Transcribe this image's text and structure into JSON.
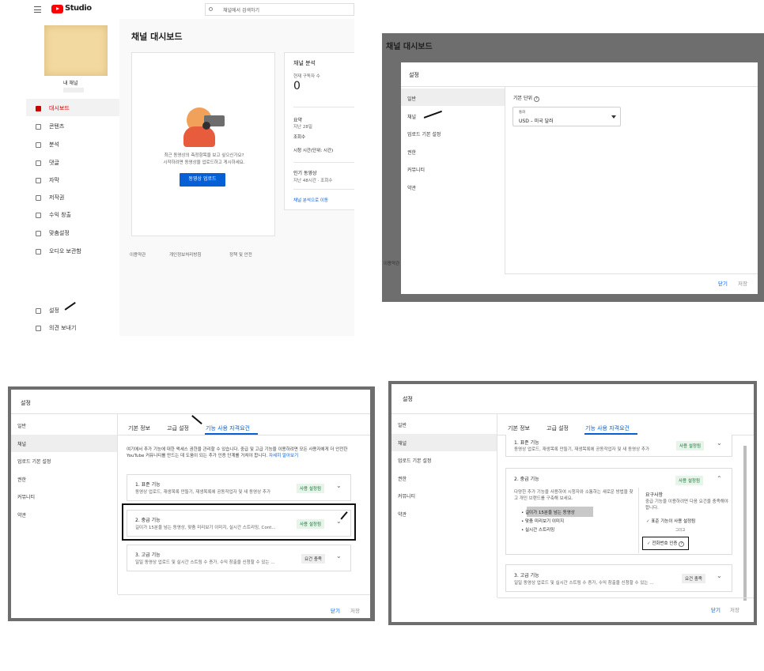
{
  "panel1": {
    "logo_text": "Studio",
    "search_placeholder": "채널에서 검색하기",
    "channel_name": "내 채널",
    "menu": [
      {
        "label": "대시보드",
        "icon": "dashboard-icon"
      },
      {
        "label": "콘텐츠",
        "icon": "content-icon"
      },
      {
        "label": "분석",
        "icon": "analytics-icon"
      },
      {
        "label": "댓글",
        "icon": "comments-icon"
      },
      {
        "label": "자막",
        "icon": "subtitles-icon"
      },
      {
        "label": "저작권",
        "icon": "copyright-icon"
      },
      {
        "label": "수익 창출",
        "icon": "monetization-icon"
      },
      {
        "label": "맞춤설정",
        "icon": "customization-icon"
      },
      {
        "label": "오디오 보관함",
        "icon": "audio-library-icon"
      },
      {
        "label": "설정",
        "icon": "settings-icon"
      },
      {
        "label": "의견 보내기",
        "icon": "feedback-icon"
      }
    ],
    "page_title": "채널 대시보드",
    "upload_card": {
      "line1": "최근 동영상의 측정항목을 보고 싶으신가요?",
      "line2": "시작하려면 동영상을 업로드하고 게시하세요.",
      "button": "동영상 업로드"
    },
    "analytics": {
      "title": "채널 분석",
      "subs_label": "현재 구독자 수",
      "subs_value": "0",
      "summary_title": "요약",
      "summary_period": "지난 28일",
      "views_label": "조회수",
      "watch_label": "시청 시간(단위: 시간)",
      "popular_title": "인기 동영상",
      "popular_period": "지난 48시간 · 조회수",
      "link": "채널 분석으로 이동"
    },
    "footer": [
      "이용약관",
      "개인정보처리방침",
      "정책 및 안전"
    ]
  },
  "panel2": {
    "bg_title": "채널 대시보드",
    "bg_footer": "이용약관",
    "dialog_title": "설정",
    "nav": [
      "일반",
      "채널",
      "업로드 기본 설정",
      "권한",
      "커뮤니티",
      "약관"
    ],
    "currency_label": "기본 단위",
    "currency_field_label": "통화",
    "currency_value": "USD – 미국 달러",
    "close": "닫기",
    "save": "저장"
  },
  "panel3": {
    "dialog_title": "설정",
    "nav": [
      "일반",
      "채널",
      "업로드 기본 설정",
      "권한",
      "커뮤니티",
      "약관"
    ],
    "tabs": [
      "기본 정보",
      "고급 설정",
      "기능 사용 자격요건"
    ],
    "intro": "여기에서 추가 기능에 대한 액세스 권한을 관리할 수 있습니다. 중급 및 고급 기능을 이용하려면 모든 사용자에게 더 안전한 YouTube 커뮤니티를 만드는 데 도움이 되는 추가 인증 단계를 거쳐야 합니다.",
    "intro_link": "자세히 알아보기",
    "features": [
      {
        "title": "1. 표준 기능",
        "desc": "동영상 업로드, 재생목록 만들기, 재생목록에 공동작업자 및 새 동영상 추가",
        "badge": "사용 설정됨"
      },
      {
        "title": "2. 중급 기능",
        "desc": "길이가 15분을 넘는 동영상, 맞춤 미리보기 이미지, 실시간 스트리밍, Cont...",
        "badge": "사용 설정됨"
      },
      {
        "title": "3. 고급 기능",
        "desc": "일일 동영상 업로드 및 실시간 스트링 수 증가, 수익 창출을 신청할 수 있는 ...",
        "badge": "요건 충족"
      }
    ],
    "close": "닫기",
    "save": "저장"
  },
  "panel4": {
    "dialog_title": "설정",
    "nav": [
      "일반",
      "채널",
      "업로드 기본 설정",
      "권한",
      "커뮤니티",
      "약관"
    ],
    "tabs": [
      "기본 정보",
      "고급 설정",
      "기능 사용 자격요건"
    ],
    "f1": {
      "title": "1. 표준 기능",
      "desc": "동영상 업로드, 재생목록 만들기, 재생목록에 공동작업자 및 새 동영상 추가",
      "badge": "사용 설정됨"
    },
    "f2": {
      "title": "2. 중급 기능",
      "badge": "사용 설정됨",
      "desc": "다양한 추가 기능을 사용하여 시청자와 소통하는 새로운 방법을 찾고 개인 브랜드를 구축해 보세요.",
      "bullets": [
        "길이가 15분을 넘는 동영상",
        "맞춤 미리보기 이미지",
        "실시간 스트리밍"
      ],
      "req_title": "요구사항",
      "req_desc": "중급 기능을 이용하려면 다음 요건을 충족해야 합니다.",
      "req1": "표준 기능이 사용 설정됨",
      "and": "그리고",
      "req2": "전화번호 인증"
    },
    "f3": {
      "title": "3. 고급 기능",
      "desc": "일일 동영상 업로드 및 실시간 스트링 수 증가, 수익 창출을 신청할 수 있는 ...",
      "badge": "요건 충족"
    },
    "close": "닫기",
    "save": "저장"
  }
}
